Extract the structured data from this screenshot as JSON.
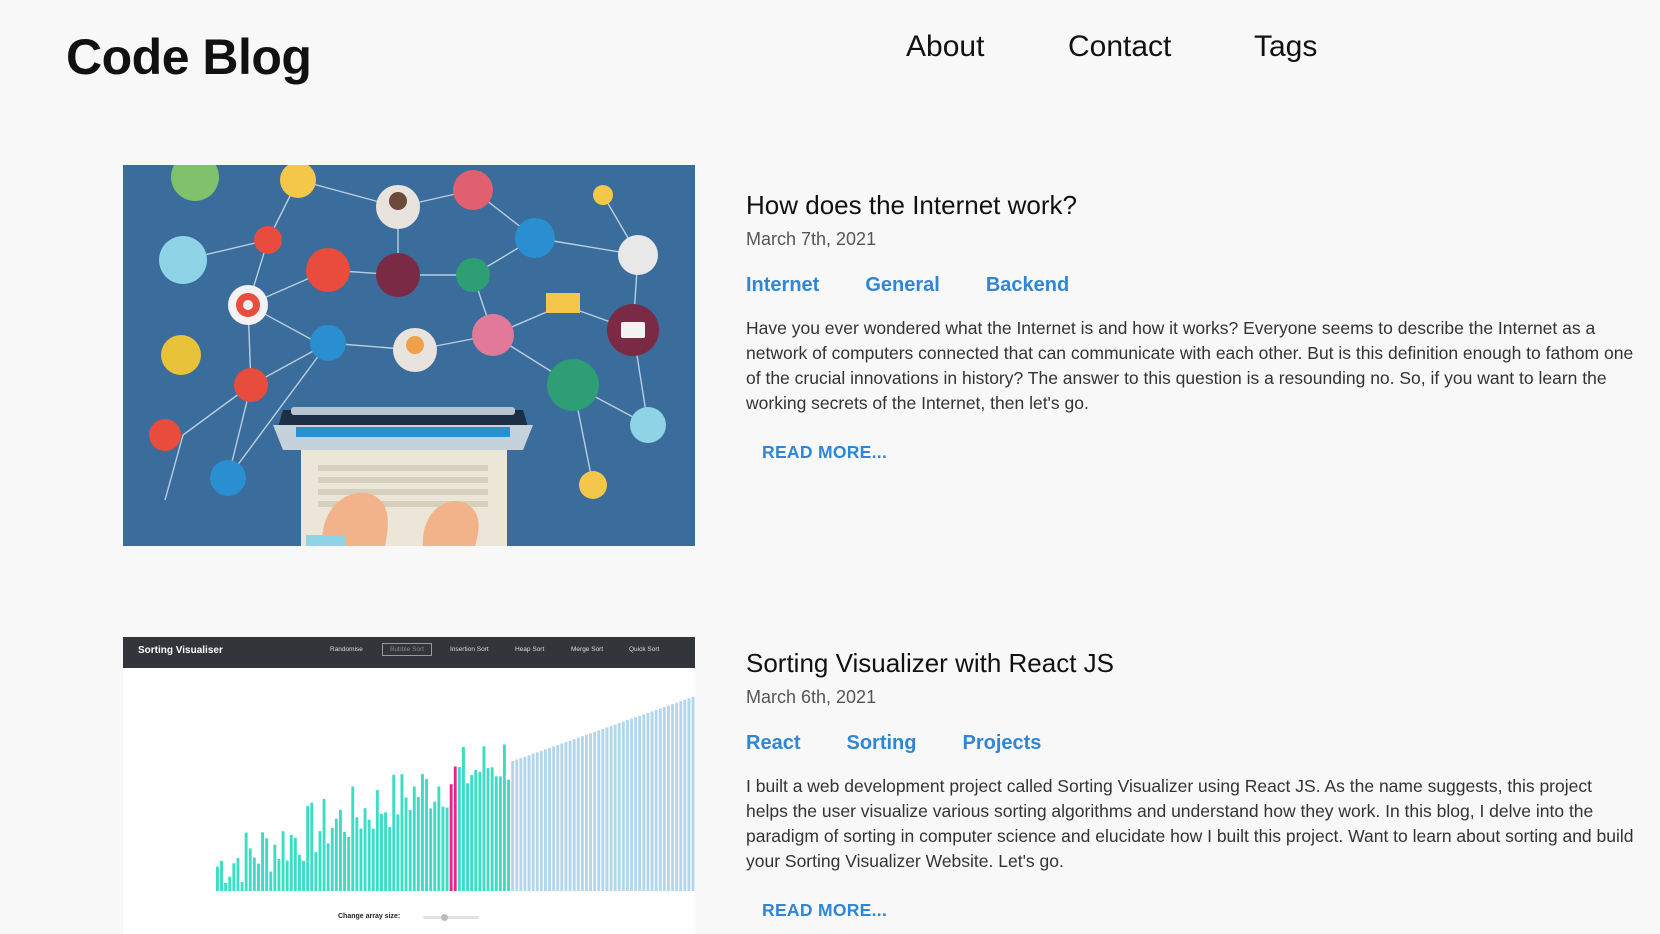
{
  "header": {
    "brand": "Code Blog",
    "nav": [
      "About",
      "Contact",
      "Tags"
    ]
  },
  "posts": [
    {
      "title": "How does the Internet work?",
      "date": "March 7th, 2021",
      "tags": [
        "Internet",
        "General",
        "Backend"
      ],
      "excerpt": "Have you ever wondered what the Internet is and how it works? Everyone seems to describe the Internet as a network of computers connected that can communicate with each other. But is this definition enough to fathom one of the crucial innovations in history? The answer to this question is a resounding no. So, if you want to learn the working secrets of the Internet, then let's go.",
      "read_more": "READ MORE...",
      "thumbnail": {
        "icon": "network-illustration",
        "bg": "#3a6d9b"
      }
    },
    {
      "title": "Sorting Visualizer with React JS",
      "date": "March 6th, 2021",
      "tags": [
        "React",
        "Sorting",
        "Projects"
      ],
      "excerpt": "I built a web development project called Sorting Visualizer using React JS. As the name suggests, this project helps the user visualize various sorting algorithms and understand how they work. In this blog, I delve into the paradigm of sorting in computer science and elucidate how I built this project. Want to learn about sorting and build your Sorting Visualizer Website. Let's go.",
      "read_more": "READ MORE...",
      "thumbnail": {
        "app_title": "Sorting Visualiser",
        "menu": [
          "Randomise",
          "Bubble Sort",
          "Insertion Sort",
          "Heap Sort",
          "Merge Sort",
          "Quick Sort"
        ],
        "slider_label": "Change array size:",
        "colors": {
          "topbar": "#32363b",
          "bar": "#3ddcc4",
          "sorted": "#b4d6ea",
          "active": "#e8248c"
        }
      }
    }
  ],
  "colors": {
    "accent": "#2f86d6",
    "background": "#f8f8f8"
  }
}
